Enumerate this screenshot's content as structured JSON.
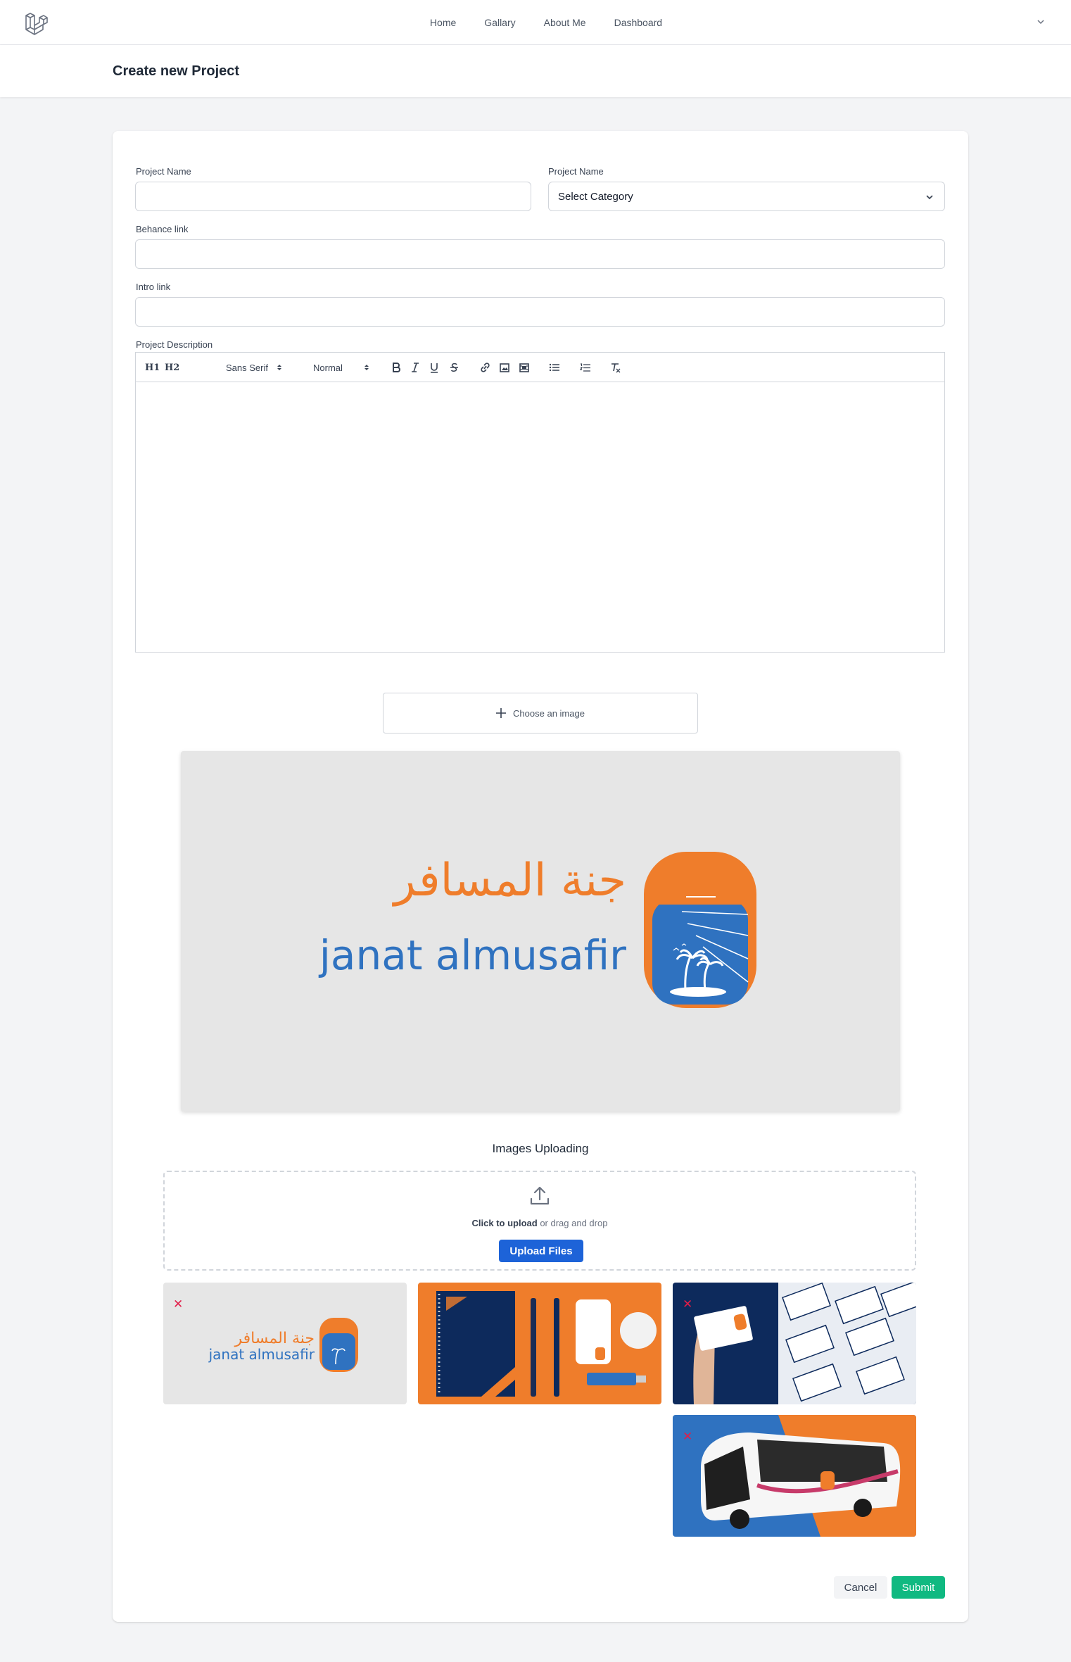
{
  "nav": {
    "links": [
      "Home",
      "Gallary",
      "About Me",
      "Dashboard"
    ]
  },
  "header": {
    "title": "Create new Project"
  },
  "form": {
    "project_name_label": "Project Name",
    "project_name_value": "",
    "category_label": "Project Name",
    "category_value": "Select Category",
    "behance_label": "Behance link",
    "behance_value": "",
    "intro_label": "Intro link",
    "intro_value": "",
    "description_label": "Project Description",
    "editor": {
      "h1": "H1",
      "h2": "H2",
      "font": "Sans Serif",
      "size": "Normal"
    },
    "choose_image": "Choose an image"
  },
  "preview": {
    "arabic_text": "جنة المسافر",
    "latin_text": "janat almusafir"
  },
  "upload": {
    "title": "Images Uploading",
    "click_text": "Click to upload",
    "drag_text": " or drag and drop",
    "button": "Upload Files",
    "remove_symbol": "✕"
  },
  "actions": {
    "cancel": "Cancel",
    "submit": "Submit"
  },
  "colors": {
    "brand_orange": "#ef7d2b",
    "brand_blue": "#2f72c0",
    "navy": "#0d2a5c",
    "submit_green": "#10b981",
    "upload_blue": "#1d63d8"
  }
}
